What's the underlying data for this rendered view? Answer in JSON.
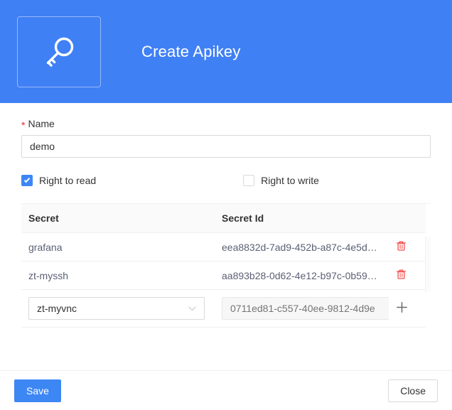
{
  "header": {
    "title": "Create Apikey",
    "icon": "key-icon",
    "background_color": "#4080f5"
  },
  "form": {
    "name_field": {
      "required_marker": "*",
      "label": "Name",
      "value": "demo",
      "placeholder": ""
    },
    "permissions": [
      {
        "label": "Right to read",
        "checked": true
      },
      {
        "label": "Right to write",
        "checked": false
      }
    ]
  },
  "secret_table": {
    "columns": [
      "Secret",
      "Secret Id"
    ],
    "rows": [
      {
        "secret": "grafana",
        "secret_id": "eea8832d-7ad9-452b-a87c-4e5d…",
        "delete_icon": "trash-icon"
      },
      {
        "secret": "zt-myssh",
        "secret_id": "aa893b28-0d62-4e12-b97c-0b59…",
        "delete_icon": "trash-icon"
      }
    ],
    "editor_row": {
      "select_value": "zt-myvnc",
      "select_icon": "chevron-down-icon",
      "secret_id_placeholder": "0711ed81-c557-40ee-9812-4d9e",
      "secret_id_value": "",
      "add_icon": "plus-icon"
    }
  },
  "footer": {
    "save_label": "Save",
    "close_label": "Close"
  },
  "colors": {
    "accent": "#3d87f5",
    "header_blue": "#4080f5",
    "danger": "#f5504e",
    "required": "#f5222d"
  }
}
